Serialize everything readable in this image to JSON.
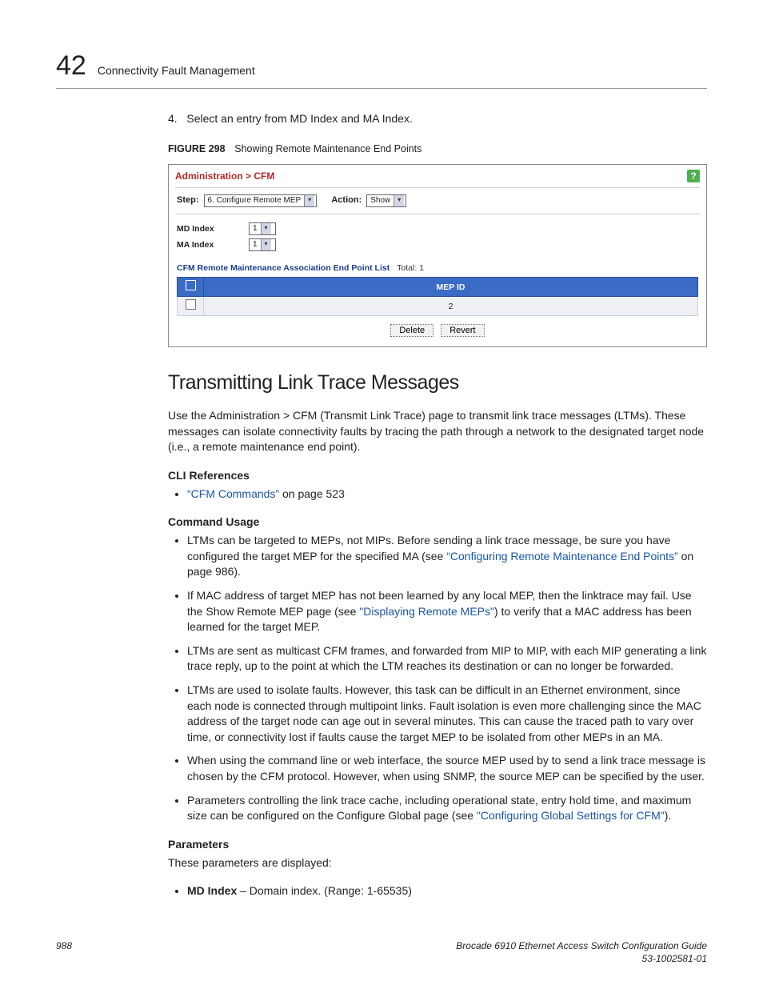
{
  "header": {
    "chapter_number": "42",
    "chapter_title": "Connectivity Fault Management"
  },
  "step": {
    "number": "4.",
    "text": "Select an entry from MD Index and MA Index."
  },
  "figure": {
    "label": "FIGURE 298",
    "title": "Showing Remote Maintenance End Points"
  },
  "ui_panel": {
    "breadcrumb": "Administration > CFM",
    "step_label": "Step:",
    "step_value": "6. Configure Remote MEP",
    "action_label": "Action:",
    "action_value": "Show",
    "md_index_label": "MD Index",
    "md_index_value": "1",
    "ma_index_label": "MA Index",
    "ma_index_value": "1",
    "list_title": "CFM Remote Maintenance Association End Point List",
    "list_total_label": "Total:",
    "list_total_value": "1",
    "table": {
      "header_mep": "MEP ID",
      "row_value": "2"
    },
    "buttons": {
      "delete": "Delete",
      "revert": "Revert"
    }
  },
  "section": {
    "title": "Transmitting Link Trace Messages",
    "intro": "Use the Administration > CFM (Transmit Link Trace) page to transmit link trace messages (LTMs). These messages can isolate connectivity faults by tracing the path through a network to the designated target node (i.e., a remote maintenance end point).",
    "cli_ref_heading": "CLI References",
    "cli_ref_link": "“CFM Commands”",
    "cli_ref_tail": " on page 523",
    "cmd_usage_heading": "Command Usage",
    "cmd_usage": {
      "b1_a": "LTMs can be targeted to MEPs, not MIPs. Before sending a link trace message, be sure you have configured the target MEP for the specified MA (see ",
      "b1_link": "“Configuring Remote Maintenance End Points”",
      "b1_b": " on page 986).",
      "b2_a": "If MAC address of target MEP has not been learned by any local MEP, then the linktrace may fail. Use the Show Remote MEP page (see ",
      "b2_link": "\"Displaying Remote MEPs\"",
      "b2_b": ") to verify that a MAC address has been learned for the target MEP.",
      "b3": "LTMs are sent as multicast CFM frames, and forwarded from MIP to MIP, with each MIP generating a link trace reply, up to the point at which the LTM reaches its destination or can no longer be forwarded.",
      "b4": "LTMs are used to isolate faults. However, this task can be difficult in an Ethernet environment, since each node is connected through multipoint links. Fault isolation is even more challenging since the MAC address of the target node can age out in several minutes. This can cause the traced path to vary over time, or connectivity lost if faults cause the target MEP to be isolated from other MEPs in an MA.",
      "b5": "When using the command line or web interface, the source MEP used by to send a link trace message is chosen by the CFM protocol. However, when using SNMP, the source MEP can be specified by the user.",
      "b6_a": "Parameters controlling the link trace cache, including operational state, entry hold time, and maximum size can be configured on the Configure Global page (see ",
      "b6_link": "\"Configuring Global Settings for CFM\"",
      "b6_b": ")."
    },
    "params_heading": "Parameters",
    "params_intro": "These parameters are displayed:",
    "param1_bold": "MD Index",
    "param1_rest": " – Domain index. (Range: 1-65535)"
  },
  "footer": {
    "page": "988",
    "pub1": "Brocade 6910 Ethernet Access Switch Configuration Guide",
    "pub2": "53-1002581-01"
  }
}
